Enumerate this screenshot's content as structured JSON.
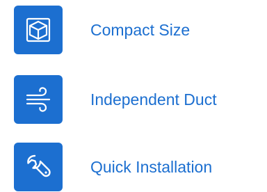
{
  "features": [
    {
      "label": "Compact Size",
      "icon": "cube-icon"
    },
    {
      "label": "Independent Duct",
      "icon": "airflow-icon"
    },
    {
      "label": "Quick Installation",
      "icon": "wrench-icon"
    }
  ],
  "colors": {
    "accent": "#1c6fd0",
    "icon_stroke": "#ffffff",
    "background": "#ffffff"
  }
}
